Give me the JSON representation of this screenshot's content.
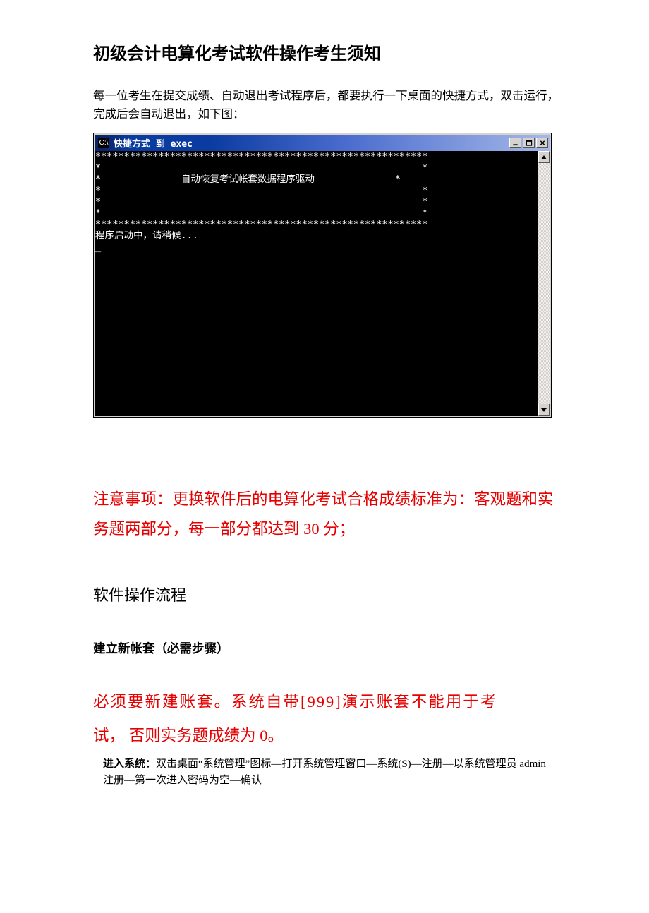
{
  "title": "初级会计电算化考试软件操作考生须知",
  "intro": "每一位考生在提交成绩、自动退出考试程序后，都要执行一下桌面的快捷方式，双击运行，完成后会自动退出，如下图：",
  "console": {
    "icon_label": "C:\\",
    "title_text": "快捷方式 到 exec",
    "buttons": {
      "minimize": "minimize",
      "maximize": "maximize",
      "close": "close"
    },
    "lines": {
      "stars_top": "**********************************************************",
      "blank_starred": "*                                                        *",
      "centered": "*              自动恢复考试帐套数据程序驱动              *",
      "stars_bottom": "**********************************************************",
      "starting": "程序启动中，请稍候...",
      "cursor": "_"
    }
  },
  "notice_red": "注意事项：更换软件后的电算化考试合格成绩标准为：客观题和实务题两部分，每一部分都达到 30 分；",
  "section_heading": "软件操作流程",
  "sub_heading": "建立新帐套（必需步骤）",
  "must_build_line1": "必须要新建账套。系统自带[999]演示账套不能用于考",
  "must_build_line2": "试，  否则实务题成绩为 0。",
  "enter_system_label": "进入系统：",
  "enter_system_text": "双击桌面“系统管理”图标—打开系统管理窗口—系统(S)—注册—以系统管理员 admin 注册—第一次进入密码为空—确认"
}
